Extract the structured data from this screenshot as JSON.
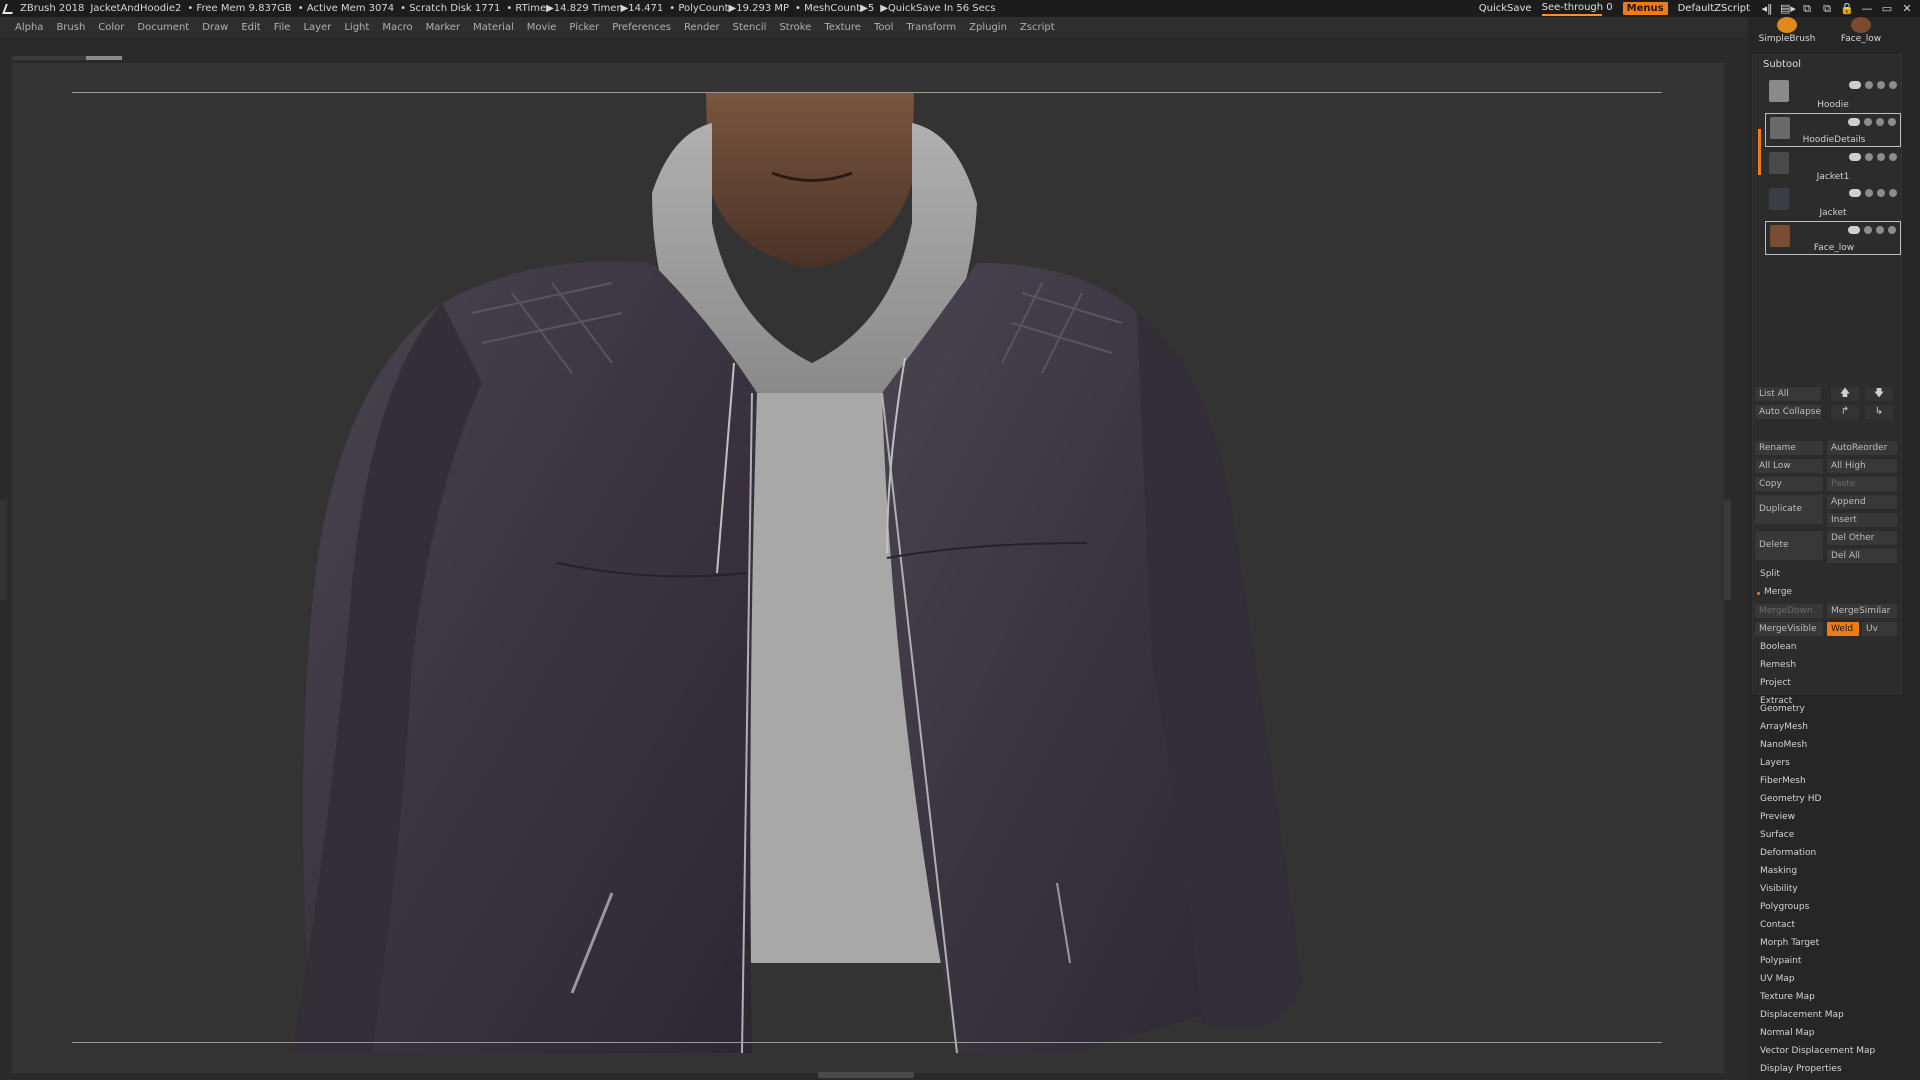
{
  "titlebar": {
    "app": "ZBrush 2018",
    "project": "JacketAndHoodie2",
    "free_mem": "• Free Mem 9.837GB",
    "active_mem": "• Active Mem 3074",
    "scratch_disk": "• Scratch Disk 1771",
    "rtime": "• RTime▶14.829 Timer▶14.471",
    "polycount": "• PolyCount▶19.293 MP",
    "meshcount": "• MeshCount▶5",
    "quicksave_in": "▶QuickSave In 56 Secs",
    "quicksave_btn": "QuickSave",
    "seethrough": "See-through  0",
    "menus_btn": "Menus",
    "default_script": "DefaultZScript",
    "win_icons": [
      "◂‖",
      "▤▸",
      "⧉",
      "⧉",
      "🔒",
      "—",
      "▭",
      "✕"
    ]
  },
  "menubar": {
    "items": [
      "Alpha",
      "Brush",
      "Color",
      "Document",
      "Draw",
      "Edit",
      "File",
      "Layer",
      "Light",
      "Macro",
      "Marker",
      "Material",
      "Movie",
      "Picker",
      "Preferences",
      "Render",
      "Stencil",
      "Stroke",
      "Texture",
      "Tool",
      "Transform",
      "Zplugin",
      "Zscript"
    ]
  },
  "brushes": {
    "slot1": "SimpleBrush",
    "slot2": "Face_low",
    "colors": {
      "slot1": "#e08a1e",
      "slot2": "#7b4a2e"
    }
  },
  "subtool": {
    "title": "Subtool",
    "items": [
      {
        "name": "Hoodie",
        "thumb_color": "#8a8a8a"
      },
      {
        "name": "HoodieDetails",
        "thumb_color": "#6a6a6a"
      },
      {
        "name": "Jacket1",
        "thumb_color": "#4a4a4a"
      },
      {
        "name": "Jacket",
        "thumb_color": "#3c3c44"
      },
      {
        "name": "Face_low",
        "thumb_color": "#7a4c34"
      }
    ],
    "list_all": "List All",
    "auto_collapse": "Auto Collapse",
    "arrow_up": "🡅",
    "arrow_down": "🡇",
    "arrow_curve": "↱",
    "arrow_curve2": "↳",
    "rename": "Rename",
    "auto_reorder": "AutoReorder",
    "all_low": "All Low",
    "all_high": "All High",
    "copy": "Copy",
    "paste": "Paste",
    "duplicate": "Duplicate",
    "append": "Append",
    "insert": "Insert",
    "delete": "Delete",
    "del_other": "Del Other",
    "del_all": "Del All",
    "split": "Split",
    "merge": "Merge",
    "merge_down": "MergeDown",
    "merge_similar": "MergeSimilar",
    "merge_visible": "MergeVisible",
    "weld": "Weld",
    "uv": "Uv",
    "boolean": "Boolean",
    "remesh": "Remesh",
    "project": "Project",
    "extract": "Extract"
  },
  "tool_palettes": [
    "Geometry",
    "ArrayMesh",
    "NanoMesh",
    "Layers",
    "FiberMesh",
    "Geometry HD",
    "Preview",
    "Surface",
    "Deformation",
    "Masking",
    "Visibility",
    "Polygroups",
    "Contact",
    "Morph Target",
    "Polypaint",
    "UV Map",
    "Texture Map",
    "Displacement Map",
    "Normal Map",
    "Vector Displacement Map",
    "Display Properties"
  ],
  "colors": {
    "accent": "#f07b14",
    "jacket": "#3a3440",
    "hoodie": "#9c9c9c",
    "skin": "#6e4a35"
  }
}
